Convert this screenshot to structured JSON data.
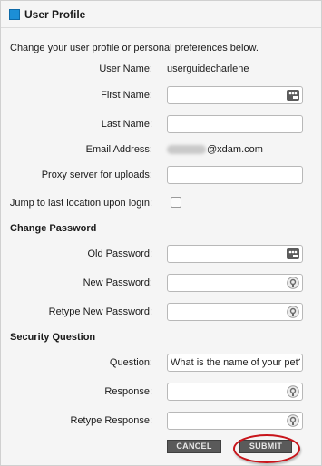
{
  "panel": {
    "title": "User Profile",
    "intro": "Change your user profile or personal preferences below."
  },
  "profile": {
    "username_label": "User Name:",
    "username_value": "userguidecharlene",
    "first_name_label": "First Name:",
    "first_name_value": "",
    "last_name_label": "Last Name:",
    "last_name_value": "",
    "email_label": "Email Address:",
    "email_domain": "@xdam.com",
    "proxy_label": "Proxy server for uploads:",
    "proxy_value": "",
    "jump_label": "Jump to last location upon login:",
    "jump_checked": false
  },
  "password": {
    "heading": "Change Password",
    "old_label": "Old Password:",
    "new_label": "New Password:",
    "retype_label": "Retype New Password:"
  },
  "security": {
    "heading": "Security Question",
    "question_label": "Question:",
    "question_value": "What is the name of your pet?",
    "response_label": "Response:",
    "retype_response_label": "Retype Response:"
  },
  "actions": {
    "cancel_label": "CANCEL",
    "submit_label": "SUBMIT"
  },
  "colors": {
    "accent": "#1c8fd6",
    "button_bg": "#5a5a5a",
    "highlight_circle": "#c8141a"
  },
  "icons": {
    "title": "square-icon",
    "autofill": "password-manager-key-icon",
    "lock": "password-lock-icon"
  }
}
